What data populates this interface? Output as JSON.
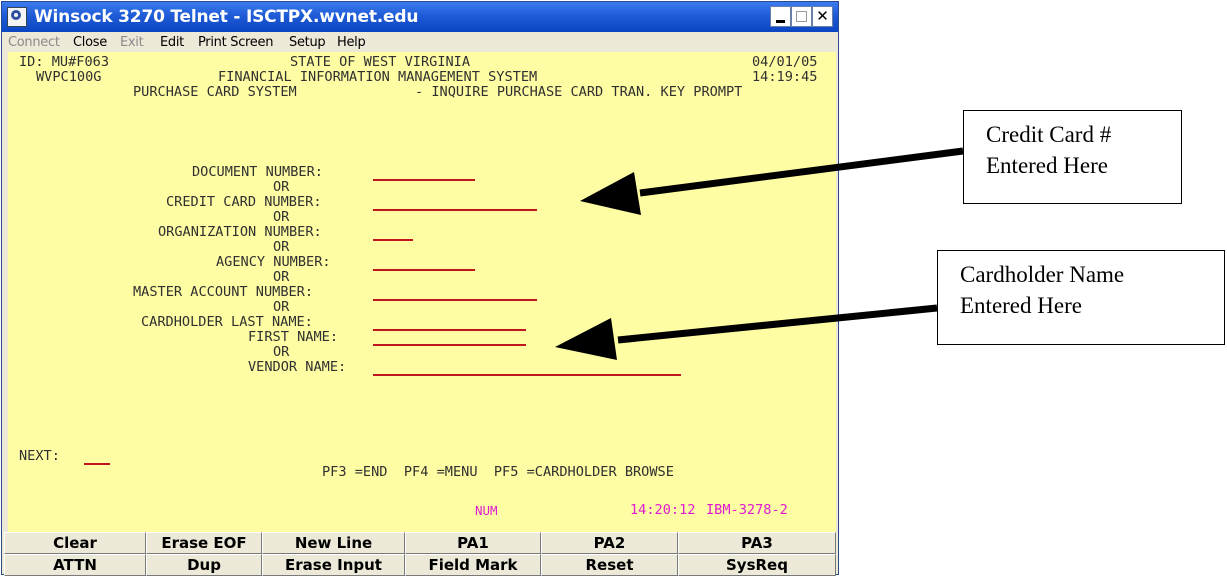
{
  "window": {
    "title": "Winsock 3270 Telnet - ISCTPX.wvnet.edu"
  },
  "menu": [
    {
      "label": "Connect",
      "enabled": false
    },
    {
      "label": "Close",
      "enabled": true
    },
    {
      "label": "Exit",
      "enabled": false
    },
    {
      "label": "Edit",
      "enabled": true
    },
    {
      "label": "Print Screen",
      "enabled": true
    },
    {
      "label": "Setup",
      "enabled": true
    },
    {
      "label": "Help",
      "enabled": true
    }
  ],
  "screen": {
    "id_line": "ID: MU#F063",
    "state": "STATE OF WEST VIRGINIA",
    "date": "04/01/05",
    "program": "WVPC100G",
    "system": "FINANCIAL INFORMATION MANAGEMENT SYSTEM",
    "time": "14:19:45",
    "subsystem": "PURCHASE CARD SYSTEM",
    "screen_title": "- INQUIRE PURCHASE CARD TRAN. KEY PROMPT",
    "fields": {
      "document_number": "DOCUMENT NUMBER:",
      "credit_card_number": "CREDIT CARD NUMBER:",
      "organization_number": "ORGANIZATION NUMBER:",
      "agency_number": "AGENCY NUMBER:",
      "master_account_number": "MASTER ACCOUNT NUMBER:",
      "cardholder_last_name": "CARDHOLDER LAST NAME:",
      "first_name": "FIRST NAME:",
      "vendor_name": "VENDOR NAME:"
    },
    "or_label": "OR",
    "next_label": "NEXT:",
    "pf_keys": "PF3 =END  PF4 =MENU  PF5 =CARDHOLDER BROWSE",
    "status_num": "NUM",
    "status_time": "14:20:12",
    "status_terminal": "IBM-3278-2"
  },
  "buttons_row1": [
    "Clear",
    "Erase EOF",
    "New Line",
    "PA1",
    "PA2",
    "PA3"
  ],
  "buttons_row2": [
    "ATTN",
    "Dup",
    "Erase Input",
    "Field Mark",
    "Reset",
    "SysReq"
  ],
  "callouts": {
    "credit_card": [
      "Credit Card #",
      "Entered Here"
    ],
    "cardholder": [
      "Cardholder Name",
      "Entered Here"
    ]
  },
  "colors": {
    "terminal_background": "#fefda4",
    "field_underline": "#c0141e",
    "status_text": "#e01ad0",
    "titlebar": "#1f5bd6"
  }
}
